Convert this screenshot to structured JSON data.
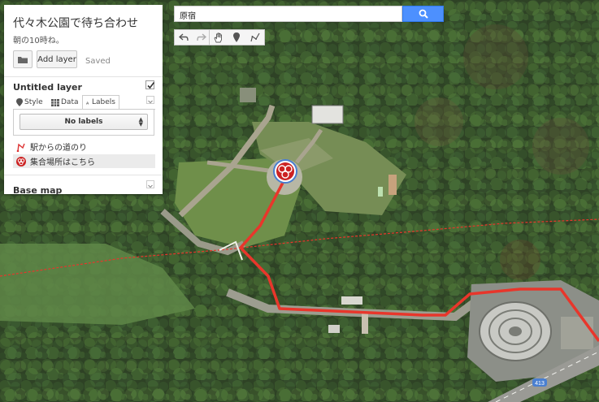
{
  "map": {
    "title": "代々木公園で待ち合わせ",
    "description": "朝の10時ね。",
    "add_layer_label": "Add layer",
    "saved_status": "Saved"
  },
  "layer": {
    "title": "Untitled layer",
    "checked": true,
    "tabs": [
      {
        "label": "Style",
        "icon": "paint-icon"
      },
      {
        "label": "Data",
        "icon": "table-icon"
      },
      {
        "label": "Labels",
        "icon": "labels-icon",
        "active": true
      }
    ],
    "labels_select": "No labels",
    "features": [
      {
        "label": "駅からの道のり",
        "icon": "line-path-icon",
        "selected": false
      },
      {
        "label": "集合場所はこちら",
        "icon": "biohazard-marker-icon",
        "selected": true
      }
    ]
  },
  "basemap": {
    "title": "Base map"
  },
  "search": {
    "value": "原宿"
  },
  "toolbar": {
    "tools": [
      "undo-icon",
      "redo-icon",
      "hand-pan-icon",
      "marker-icon",
      "draw-line-icon"
    ]
  },
  "roads": {
    "route_number": "413"
  },
  "colors": {
    "route": "#e8362b",
    "search_button": "#4d90fe",
    "marker": "#cc2222"
  }
}
